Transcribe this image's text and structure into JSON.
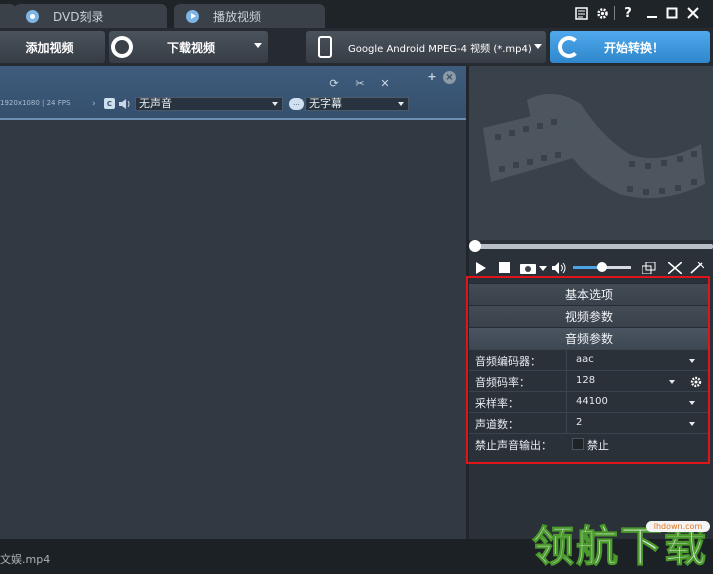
{
  "tabs": [
    {
      "label": "DVD刻录"
    },
    {
      "label": "播放视频"
    }
  ],
  "window_controls": {
    "help": "?"
  },
  "toolbar": {
    "add_video": "添加视频",
    "download_video": "下载视频",
    "output_profile": "Google Android MPEG-4 视频 (*.mp4)",
    "start_convert": "开始转换！"
  },
  "file_item": {
    "meta": "1920x1080 | 24 FPS",
    "badge": "C",
    "audio_track": "无声音",
    "subtitle": "无字幕",
    "subtitle_badge": "...",
    "filename": "文娱.mp4"
  },
  "player": {
    "seek_position": 0.0,
    "volume_level": 0.5
  },
  "settings": {
    "sections": [
      "基本选项",
      "视频参数",
      "音频参数"
    ],
    "rows": [
      {
        "label": "音频编码器：",
        "value": "aac"
      },
      {
        "label": "音频码率：",
        "value": "128"
      },
      {
        "label": "采样率：",
        "value": "44100"
      },
      {
        "label": "声道数：",
        "value": "2"
      }
    ],
    "mute_label": "禁止声音输出：",
    "mute_checkbox_label": "禁止"
  },
  "watermark": {
    "url": "lhdown.com",
    "text": "领航下载"
  },
  "colors": {
    "accent": "#3a96dc",
    "highlight_box": "#e0151c"
  }
}
